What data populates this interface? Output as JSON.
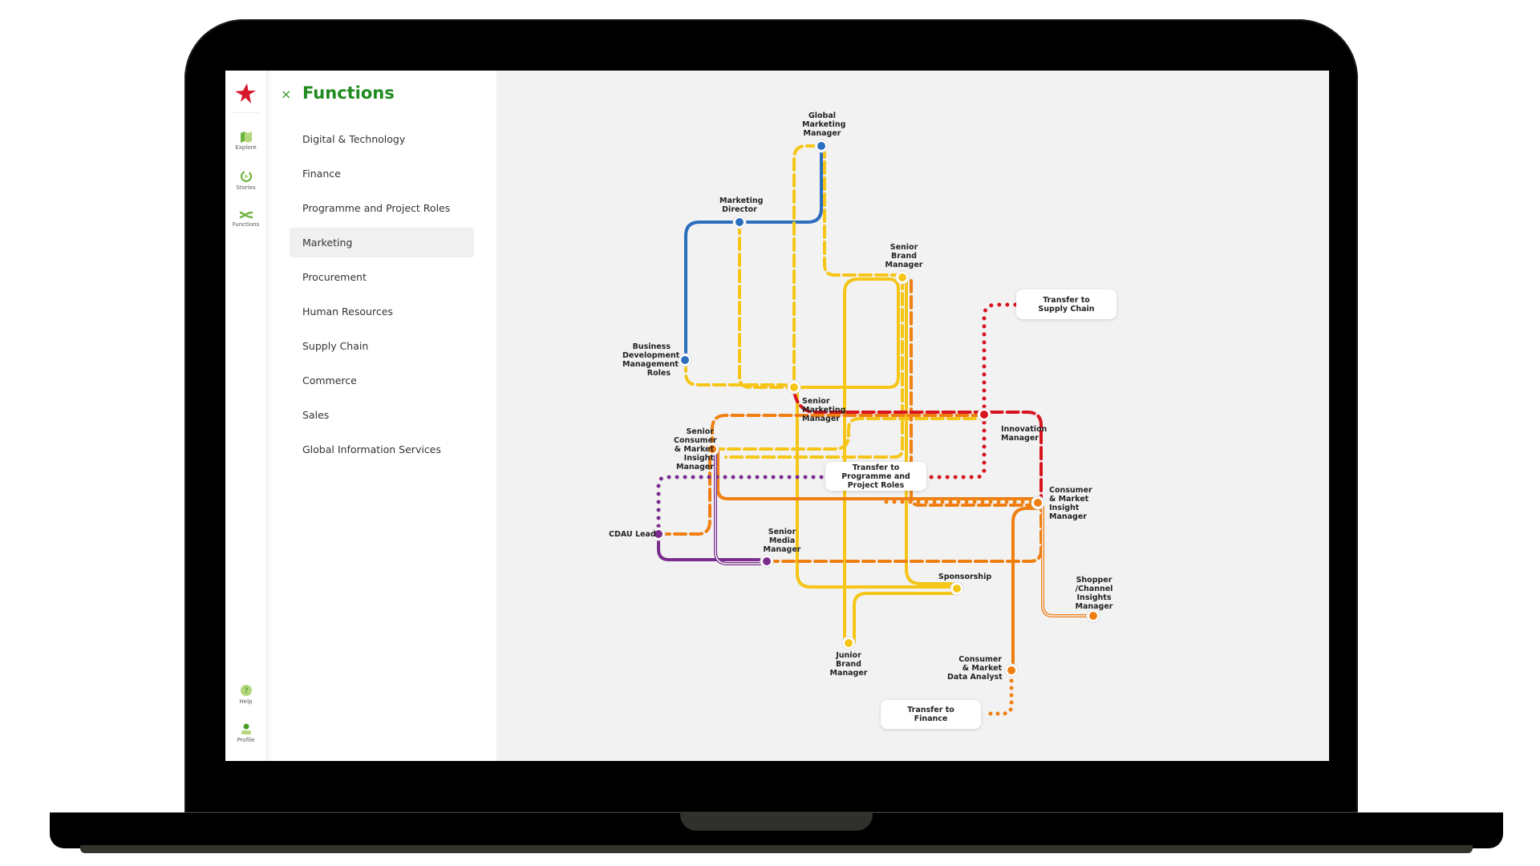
{
  "rail": {
    "items": [
      {
        "label": "Explore",
        "icon": "map-icon"
      },
      {
        "label": "Stories",
        "icon": "play-circle-icon"
      },
      {
        "label": "Functions",
        "icon": "shuffle-icon"
      }
    ],
    "bottom": [
      {
        "label": "Help",
        "icon": "help-icon"
      },
      {
        "label": "Profile",
        "icon": "profile-icon"
      }
    ]
  },
  "panel": {
    "title": "Functions",
    "close_icon": "×",
    "items": [
      {
        "label": "Digital & Technology",
        "active": false
      },
      {
        "label": "Finance",
        "active": false
      },
      {
        "label": "Programme and Project Roles",
        "active": false
      },
      {
        "label": "Marketing",
        "active": true
      },
      {
        "label": "Procurement",
        "active": false
      },
      {
        "label": "Human Resources",
        "active": false
      },
      {
        "label": "Supply Chain",
        "active": false
      },
      {
        "label": "Commerce",
        "active": false
      },
      {
        "label": "Sales",
        "active": false
      },
      {
        "label": "Global Information Services",
        "active": false
      }
    ]
  },
  "colors": {
    "brand_green": "#1f8a1f",
    "logo_red": "#d7192d",
    "blue": "#2a6ebd",
    "yellow": "#f5c518",
    "orange": "#f07f12",
    "red": "#d7141f",
    "purple": "#7b2d8e"
  },
  "map": {
    "nodes": [
      {
        "id": "gmm",
        "label": [
          "Global",
          "Marketing",
          "Manager"
        ],
        "color": "blue"
      },
      {
        "id": "md",
        "label": [
          "Marketing",
          "Director"
        ],
        "color": "blue"
      },
      {
        "id": "bdm",
        "label": [
          "Business",
          "Development",
          "Management",
          "Roles"
        ],
        "color": "blue"
      },
      {
        "id": "sbm",
        "label": [
          "Senior",
          "Brand",
          "Manager"
        ],
        "color": "yellow"
      },
      {
        "id": "smm",
        "label": [
          "Senior",
          "Marketing",
          "Manager"
        ],
        "color": "yellow"
      },
      {
        "id": "inn",
        "label": [
          "Innovation",
          "Manager"
        ],
        "color": "red"
      },
      {
        "id": "scmi",
        "label": [
          "Senior",
          "Consumer",
          "& Market",
          "Insight",
          "Manager"
        ],
        "color": "orange"
      },
      {
        "id": "cmi",
        "label": [
          "Consumer",
          "& Market",
          "Insight",
          "Manager"
        ],
        "color": "orange"
      },
      {
        "id": "cdau",
        "label": [
          "CDAU Lead"
        ],
        "color": "purple"
      },
      {
        "id": "smed",
        "label": [
          "Senior",
          "Media",
          "Manager"
        ],
        "color": "purple"
      },
      {
        "id": "spon",
        "label": [
          "Sponsorship"
        ],
        "color": "yellow"
      },
      {
        "id": "jbm",
        "label": [
          "Junior",
          "Brand",
          "Manager"
        ],
        "color": "yellow"
      },
      {
        "id": "shop",
        "label": [
          "Shopper",
          "/Channel",
          "Insights",
          "Manager"
        ],
        "color": "orange"
      },
      {
        "id": "cmda",
        "label": [
          "Consumer",
          "& Market",
          "Data Analyst"
        ],
        "color": "orange"
      }
    ],
    "transfers": [
      {
        "id": "t-supply",
        "label": [
          "Transfer to",
          "Supply Chain"
        ]
      },
      {
        "id": "t-prog",
        "label": [
          "Transfer to",
          "Programme and Project Roles"
        ]
      },
      {
        "id": "t-fin",
        "label": [
          "Transfer to",
          "Finance"
        ]
      }
    ]
  }
}
